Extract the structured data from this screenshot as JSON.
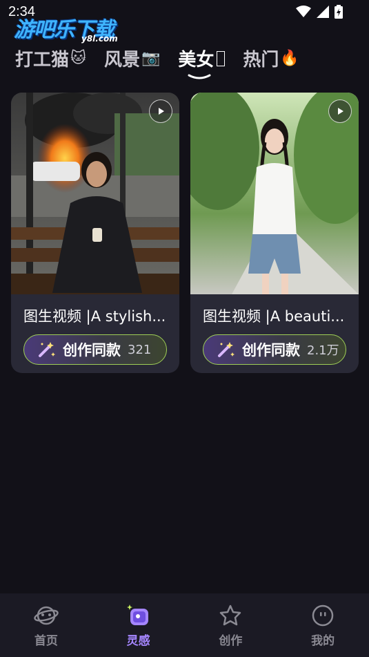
{
  "status": {
    "time": "2:34"
  },
  "watermark": {
    "main": "游吧乐下载",
    "sub": "y8l.com"
  },
  "tabs": [
    {
      "label": "打工猫",
      "emoji": "🐱",
      "active": false
    },
    {
      "label": "风景",
      "emoji": "📷",
      "active": false
    },
    {
      "label": "美女",
      "emoji": "",
      "active": true
    },
    {
      "label": "热门",
      "emoji": "🔥",
      "active": false
    }
  ],
  "cards": [
    {
      "title": "图生视频 |A stylish...",
      "action_label": "创作同款",
      "count": "321"
    },
    {
      "title": "图生视频 |A beauti...",
      "action_label": "创作同款",
      "count": "2.1万"
    }
  ],
  "nav": [
    {
      "label": "首页",
      "icon": "planet-icon",
      "active": false
    },
    {
      "label": "灵感",
      "icon": "inspiration-icon",
      "active": true
    },
    {
      "label": "创作",
      "icon": "star-create-icon",
      "active": false
    },
    {
      "label": "我的",
      "icon": "profile-face-icon",
      "active": false
    }
  ],
  "colors": {
    "accent": "#a586ff",
    "background": "#121118",
    "card": "#292936",
    "pill_border": "#9fcf56"
  }
}
